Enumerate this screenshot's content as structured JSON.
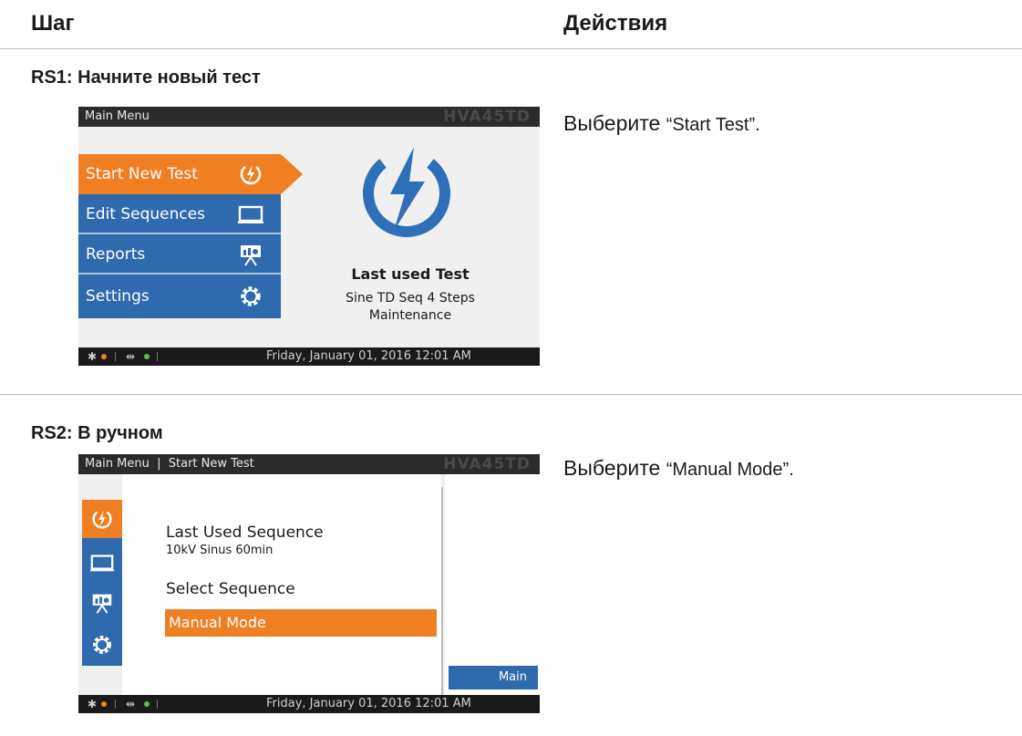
{
  "table": {
    "header_step": "Шаг",
    "header_actions": "Действия"
  },
  "rows": [
    {
      "step_title": "RS1: Начните новый тест",
      "action_prefix": "Выберите ",
      "action_quoted": "“Start Test”.",
      "screen": {
        "title": "Main Menu",
        "brand": "HVA45TD",
        "menu": [
          "Start New Test",
          "Edit Sequences",
          "Reports",
          "Settings"
        ],
        "last_used_label": "Last used Test",
        "last_used_line1": "Sine TD Seq 4 Steps",
        "last_used_line2": "Maintenance",
        "datetime": "Friday, January 01, 2016 12:01 AM"
      }
    },
    {
      "step_title": "RS2: В ручном",
      "action_prefix": "Выберите ",
      "action_quoted": "“Manual Mode”.",
      "screen": {
        "title": "Main Menu  |  Start New Test",
        "brand": "HVA45TD",
        "last_used_sequence_label": "Last Used Sequence",
        "last_used_sequence_value": "10kV Sinus 60min",
        "select_sequence": "Select Sequence",
        "manual_mode": "Manual Mode",
        "main_button": "Main",
        "datetime": "Friday, January 01, 2016 12:01 AM"
      }
    }
  ],
  "colors": {
    "accent_orange": "#f07f23",
    "menu_blue": "#2f6aae",
    "bolt_blue": "#2e6fb8"
  }
}
